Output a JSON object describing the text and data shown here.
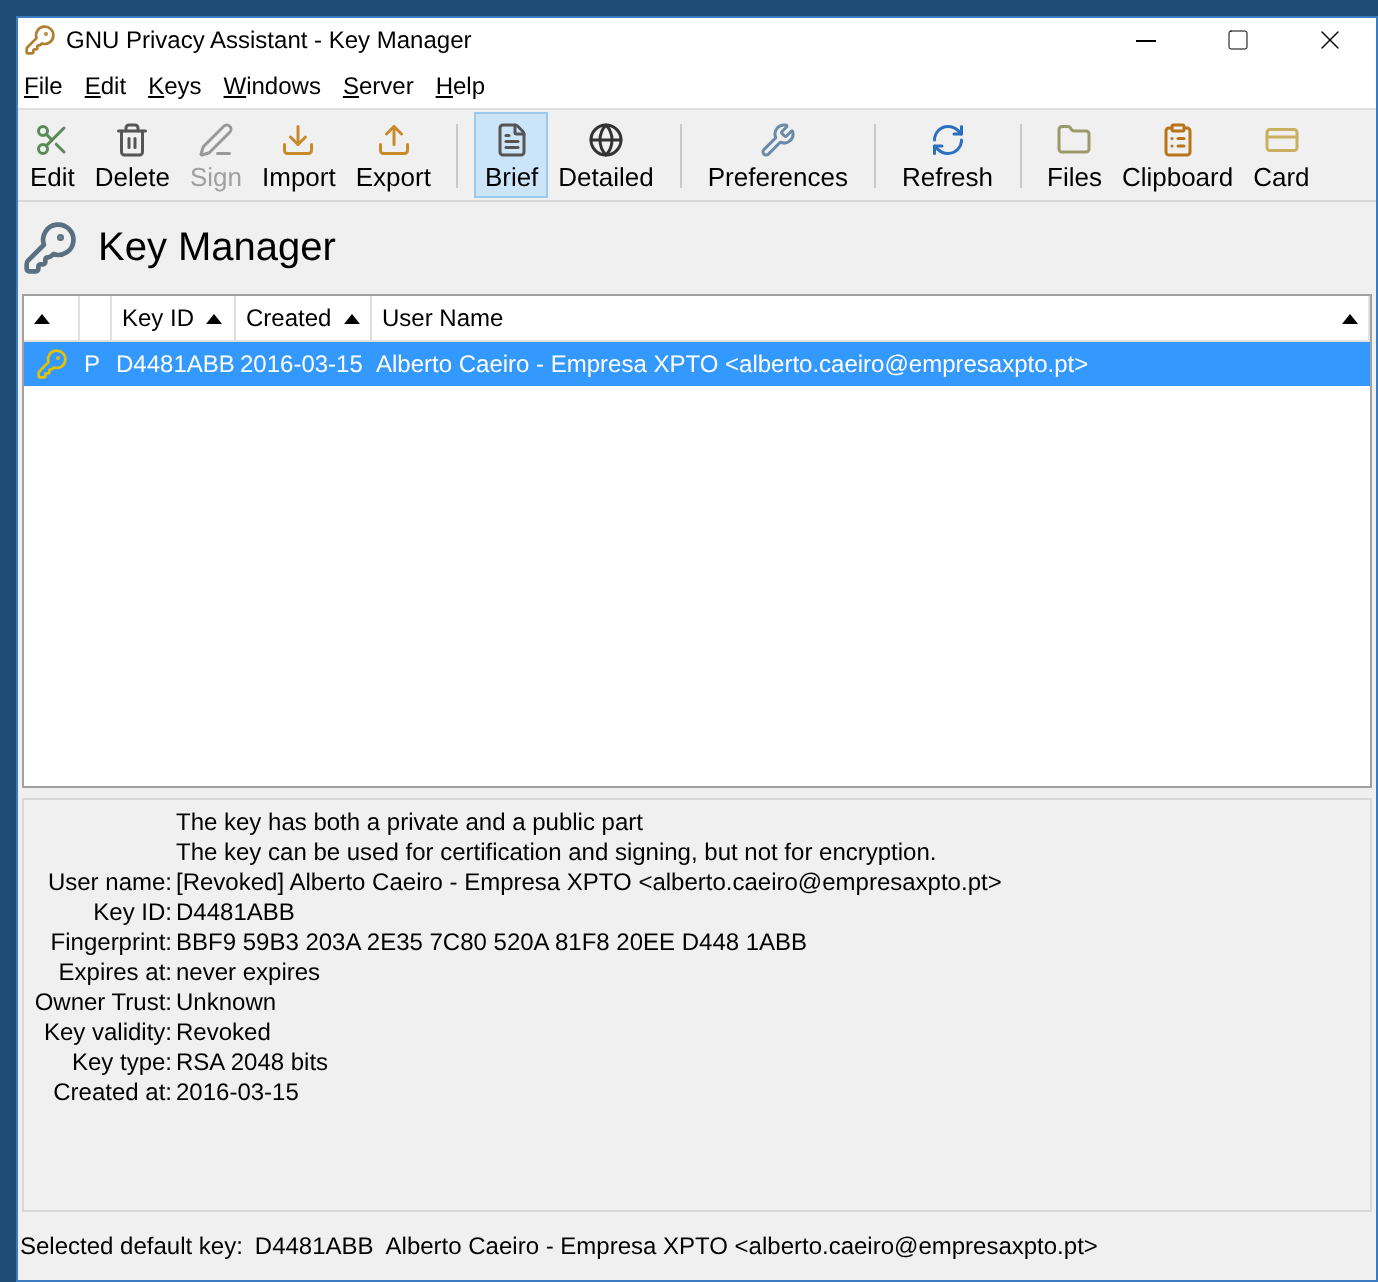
{
  "window": {
    "title": "GNU Privacy Assistant - Key Manager"
  },
  "menu": [
    {
      "label": "File"
    },
    {
      "label": "Edit"
    },
    {
      "label": "Keys"
    },
    {
      "label": "Windows"
    },
    {
      "label": "Server"
    },
    {
      "label": "Help"
    }
  ],
  "toolbar": [
    {
      "kind": "button",
      "label": "Edit",
      "disabled": false,
      "selected": false
    },
    {
      "kind": "button",
      "label": "Delete",
      "disabled": false,
      "selected": false
    },
    {
      "kind": "button",
      "label": "Sign",
      "disabled": true,
      "selected": false
    },
    {
      "kind": "button",
      "label": "Import",
      "disabled": false,
      "selected": false
    },
    {
      "kind": "button",
      "label": "Export",
      "disabled": false,
      "selected": false
    },
    {
      "kind": "separator"
    },
    {
      "kind": "button",
      "label": "Brief",
      "disabled": false,
      "selected": true
    },
    {
      "kind": "button",
      "label": "Detailed",
      "disabled": false,
      "selected": false
    },
    {
      "kind": "separator"
    },
    {
      "kind": "button",
      "label": "Preferences",
      "disabled": false,
      "selected": false
    },
    {
      "kind": "separator"
    },
    {
      "kind": "button",
      "label": "Refresh",
      "disabled": false,
      "selected": false
    },
    {
      "kind": "separator"
    },
    {
      "kind": "button",
      "label": "Files",
      "disabled": false,
      "selected": false
    },
    {
      "kind": "button",
      "label": "Clipboard",
      "disabled": false,
      "selected": false
    },
    {
      "kind": "button",
      "label": "Card",
      "disabled": false,
      "selected": false
    }
  ],
  "heading": "Key Manager",
  "table": {
    "columns": [
      {
        "sort": true
      },
      {
        "sort": false
      },
      {
        "label": "Key ID",
        "sort": true
      },
      {
        "label": "Created",
        "sort": true
      },
      {
        "label": "User Name",
        "sort": true
      }
    ],
    "rows": [
      {
        "selected": true,
        "type": "P",
        "key_id": "D4481ABB",
        "created": "2016-03-15",
        "user_name": "Alberto Caeiro - Empresa XPTO <alberto.caeiro@empresaxpto.pt>"
      }
    ]
  },
  "details": {
    "notes": [
      "The key has both a private and a public part",
      "The key can be used for certification and signing, but not for encryption."
    ],
    "fields": [
      {
        "label": "User name:",
        "value": "[Revoked] Alberto Caeiro - Empresa XPTO <alberto.caeiro@empresaxpto.pt>"
      },
      {
        "label": "Key ID:",
        "value": "D4481ABB"
      },
      {
        "label": "Fingerprint:",
        "value": "BBF9 59B3 203A 2E35 7C80  520A 81F8 20EE D448 1ABB"
      },
      {
        "label": "Expires at:",
        "value": "never expires"
      },
      {
        "label": "Owner Trust:",
        "value": "Unknown"
      },
      {
        "label": "Key validity:",
        "value": "Revoked"
      },
      {
        "label": "Key type:",
        "value": "RSA 2048 bits"
      },
      {
        "label": "Created at:",
        "value": "2016-03-15"
      }
    ]
  },
  "status_bar": {
    "label": "Selected default key:",
    "key_id": "D4481ABB",
    "user_name": "Alberto Caeiro - Empresa XPTO <alberto.caeiro@empresaxpto.pt>"
  }
}
